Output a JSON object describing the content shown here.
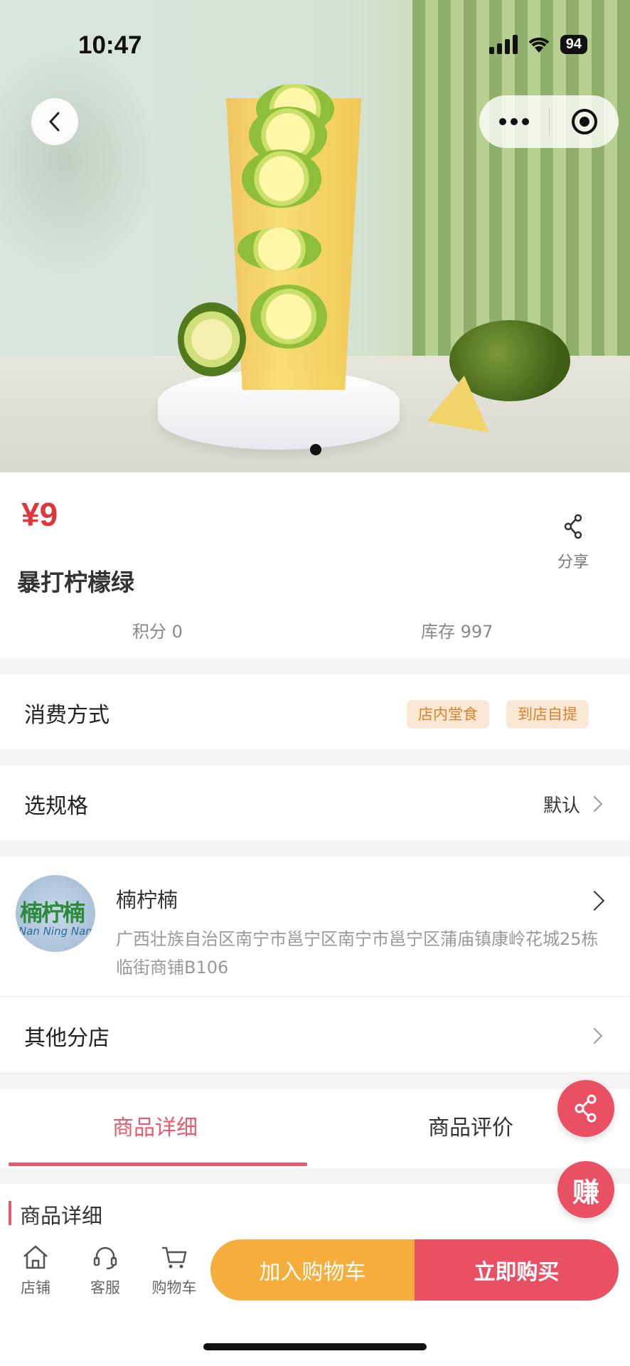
{
  "status_bar": {
    "time": "10:47",
    "battery": "94"
  },
  "product": {
    "price": "¥9",
    "name": "暴打柠檬绿",
    "share_label": "分享",
    "points": "积分 0",
    "stock": "库存 997"
  },
  "consumption": {
    "label": "消费方式",
    "tags": [
      "店内堂食",
      "到店自提"
    ]
  },
  "spec": {
    "label": "选规格",
    "value": "默认"
  },
  "store": {
    "name": "楠柠楠",
    "address": "广西壮族自治区南宁市邕宁区南宁市邕宁区蒲庙镇康岭花城25栋临街商铺B106",
    "logo_text": "楠柠楠",
    "logo_sub": "Nan Ning Nan"
  },
  "other_branches": {
    "label": "其他分店"
  },
  "tabs": [
    {
      "label": "商品详细",
      "active": true
    },
    {
      "label": "商品评价",
      "active": false
    }
  ],
  "section_title": "商品详细",
  "fab": {
    "earn_label": "赚"
  },
  "bottom_nav": [
    {
      "label": "店铺",
      "icon": "store-icon"
    },
    {
      "label": "客服",
      "icon": "headset-icon"
    },
    {
      "label": "购物车",
      "icon": "cart-icon"
    }
  ],
  "actions": {
    "add_to_cart": "加入购物车",
    "buy_now": "立即购买"
  },
  "colors": {
    "accent": "#ea5064",
    "price": "#e0353b",
    "cart_button": "#f5ad3c",
    "tag_bg": "#fbe8d4",
    "tag_text": "#d9822b"
  },
  "carousel": {
    "pages": 1,
    "current": 1
  }
}
